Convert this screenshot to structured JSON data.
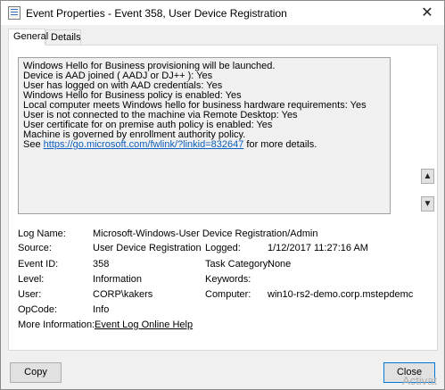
{
  "window": {
    "title": "Event Properties - Event 358, User Device Registration",
    "close_glyph": "✕"
  },
  "tabs": [
    {
      "label": "General",
      "active": true
    },
    {
      "label": "Details",
      "active": false
    }
  ],
  "description": {
    "lines": [
      "Windows Hello for Business provisioning will be launched.",
      "Device is AAD joined ( AADJ or DJ++ ): Yes",
      "User has logged on with AAD credentials: Yes",
      "Windows Hello for Business policy is enabled: Yes",
      "Local computer meets Windows hello for business hardware requirements: Yes",
      "User is not connected to the machine via Remote Desktop: Yes",
      "User certificate for on premise auth policy is enabled: Yes",
      "Machine is governed by enrollment authority policy."
    ],
    "see_prefix": "See ",
    "see_link": "https://go.microsoft.com/fwlink/?linkid=832647",
    "see_suffix": " for more details."
  },
  "scroll": {
    "up_glyph": "▲",
    "down_glyph": "▼"
  },
  "fields": {
    "log_name": {
      "label": "Log Name:",
      "value": "Microsoft-Windows-User Device Registration/Admin"
    },
    "source": {
      "label": "Source:",
      "value": "User Device Registration"
    },
    "logged": {
      "label": "Logged:",
      "value": "1/12/2017 11:27:16 AM"
    },
    "event_id": {
      "label": "Event ID:",
      "value": "358"
    },
    "task_category": {
      "label": "Task Category:",
      "value": "None"
    },
    "level": {
      "label": "Level:",
      "value": "Information"
    },
    "keywords": {
      "label": "Keywords:",
      "value": ""
    },
    "user": {
      "label": "User:",
      "value": "CORP\\kakers"
    },
    "computer": {
      "label": "Computer:",
      "value": "win10-rs2-demo.corp.mstepdemc"
    },
    "opcode": {
      "label": "OpCode:",
      "value": "Info"
    },
    "more_info": {
      "label": "More Information:",
      "value": "Event Log Online Help"
    }
  },
  "buttons": {
    "copy": "Copy",
    "close": "Close"
  },
  "watermark": "Activat"
}
